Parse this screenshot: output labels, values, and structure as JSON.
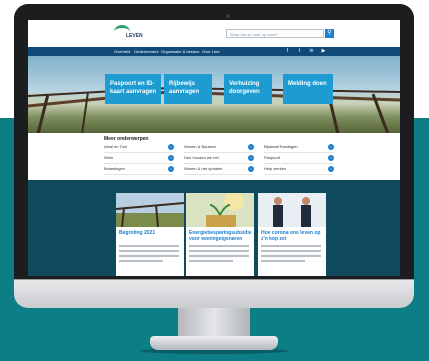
{
  "header": {
    "logo_text": "LEVEN",
    "search_placeholder": "Waar ben je naar op zoek?",
    "search_icon": "search-icon"
  },
  "nav": {
    "items": [
      "Overheid",
      "Ondernemers",
      "Organisatie & bestuur",
      "Over Leer"
    ],
    "social": [
      "facebook-icon",
      "twitter-icon",
      "linkedin-icon",
      "youtube-icon"
    ]
  },
  "hero_cards": [
    {
      "label": "Paspoort en ID-kaart aanvragen"
    },
    {
      "label": "Rijbewijs aanvragen"
    },
    {
      "label": "Verhuizing doorgeven"
    },
    {
      "label": "Melding doen"
    }
  ],
  "meer": {
    "title": "Meer onderwerpen",
    "links": [
      [
        "Afval en Tuin",
        "Wonen & Bouwen",
        "Bijstand/Toeslagen"
      ],
      [
        "Werk",
        "Hoe houden we het",
        "Paspoort"
      ],
      [
        "Belastingen",
        "Wonen & het ophalen",
        "Help werken"
      ]
    ]
  },
  "news": [
    {
      "title": "Begroting 2021"
    },
    {
      "title": "Energiebesparingsubsidie voor woningeigenaren"
    },
    {
      "title": "Hoe corona ons leven op z'n kop zet"
    }
  ],
  "colors": {
    "teal_bg": "#0d7d86",
    "navy_nav": "#0f4a78",
    "hero_card": "#1e9bd0",
    "dark_band": "#0f4a5e",
    "accent": "#1f7fd1"
  }
}
